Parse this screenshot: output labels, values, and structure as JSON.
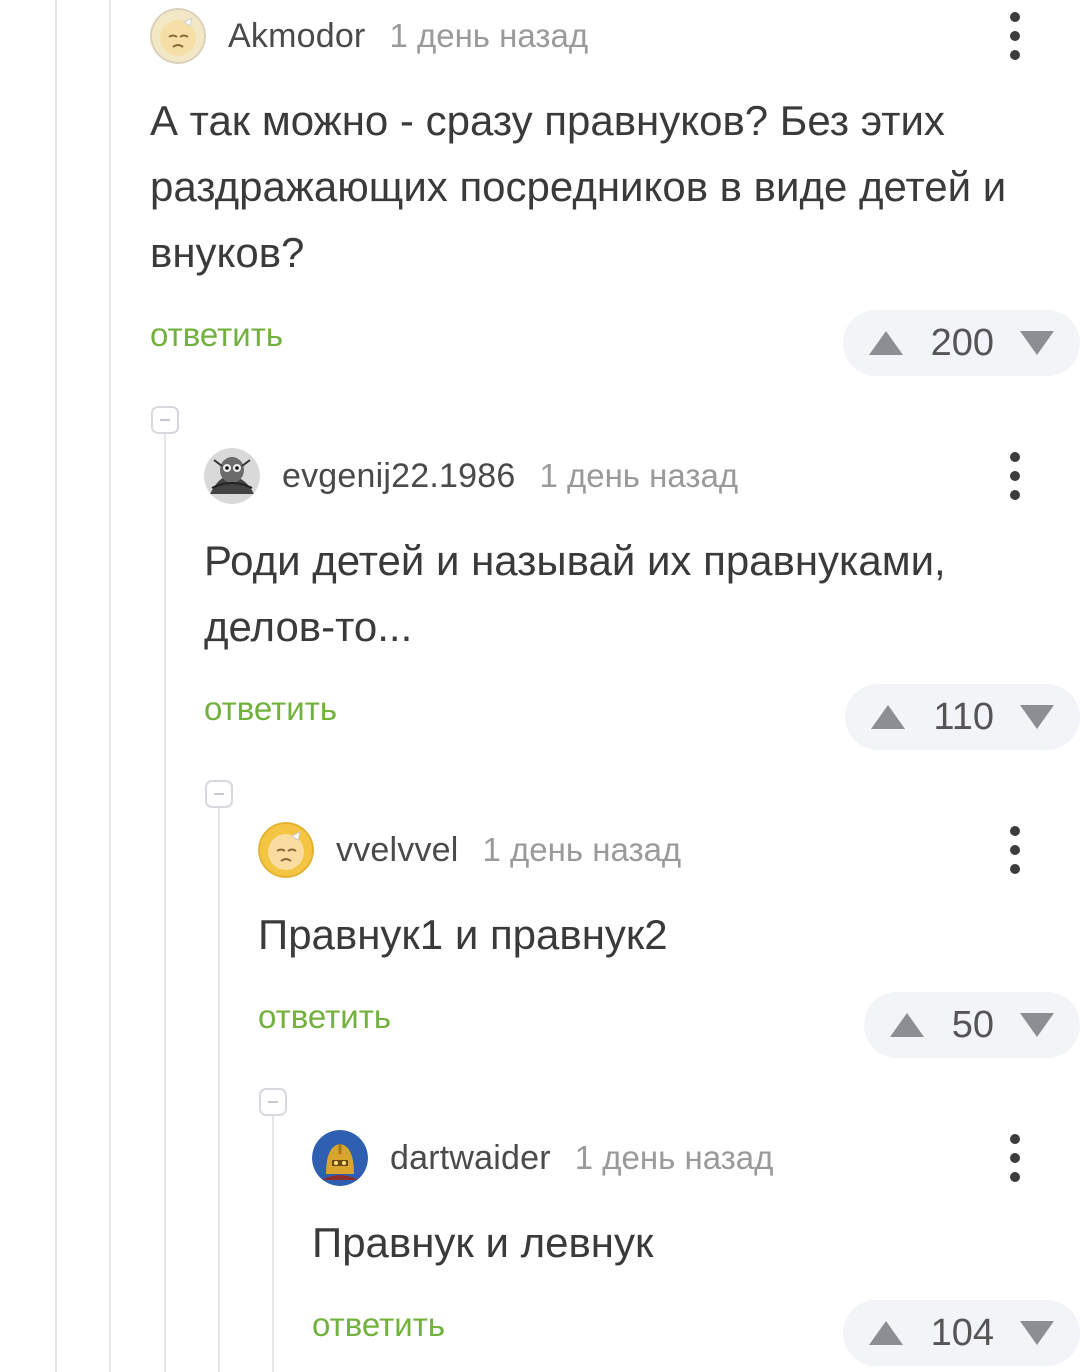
{
  "comments": [
    {
      "username": "Akmodor",
      "time": "1 день назад",
      "avatar": "crying-face-avatar",
      "text": "А так можно - сразу правнуков? Без этих раздражающих посредников в виде детей и внуков?",
      "reply_label": "ответить",
      "rating": "200"
    },
    {
      "username": "evgenij22.1986",
      "time": "1 день назад",
      "avatar": "owl-engraving-avatar",
      "text": "Роди детей и называй их правнуками, делов-то...",
      "reply_label": "ответить",
      "rating": "110"
    },
    {
      "username": "vvelvvel",
      "time": "1 день назад",
      "avatar": "crying-face-avatar",
      "text": "Правнук1 и правнук2",
      "reply_label": "ответить",
      "rating": "50"
    },
    {
      "username": "dartwaider",
      "time": "1 день назад",
      "avatar": "golden-helmet-avatar",
      "text": "Правнук и левнук",
      "reply_label": "ответить",
      "rating": "104"
    }
  ],
  "colors": {
    "accent_green": "#72b13e",
    "rating_bg": "#f2f4f7",
    "thread_line": "#e6e6e6",
    "muted_text": "#9a9a9a"
  },
  "icons": [
    "more-vertical-icon",
    "upvote-arrow-icon",
    "downvote-arrow-icon",
    "collapse-minus-icon"
  ]
}
